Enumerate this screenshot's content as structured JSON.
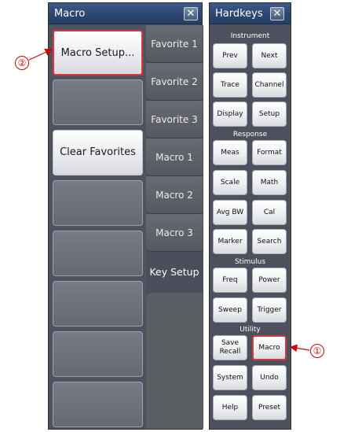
{
  "macro_panel": {
    "title": "Macro",
    "close_glyph": "✕",
    "buttons": [
      {
        "label": "Macro Setup...",
        "selected": true
      },
      {
        "label": ""
      },
      {
        "label": "Clear Favorites"
      },
      {
        "label": ""
      },
      {
        "label": ""
      },
      {
        "label": ""
      },
      {
        "label": ""
      },
      {
        "label": ""
      }
    ],
    "tabs": [
      "Favorite 1",
      "Favorite 2",
      "Favorite 3",
      "Macro 1",
      "Macro 2",
      "Macro 3",
      "Key Setup"
    ],
    "active_tab": "Key Setup"
  },
  "hardkeys_panel": {
    "title": "Hardkeys",
    "close_glyph": "✕",
    "sections": {
      "instrument": "Instrument",
      "response": "Response",
      "stimulus": "Stimulus",
      "utility": "Utility"
    },
    "keys": {
      "prev": "Prev",
      "next": "Next",
      "trace": "Trace",
      "channel": "Channel",
      "display": "Display",
      "setup": "Setup",
      "meas": "Meas",
      "format": "Format",
      "scale": "Scale",
      "math": "Math",
      "avg_bw": "Avg BW",
      "cal": "Cal",
      "marker": "Marker",
      "search": "Search",
      "freq": "Freq",
      "power": "Power",
      "sweep": "Sweep",
      "trigger": "Trigger",
      "save_recall_1": "Save",
      "save_recall_2": "Recall",
      "macro": "Macro",
      "system": "System",
      "undo": "Undo",
      "help": "Help",
      "preset": "Preset"
    }
  },
  "callouts": {
    "one": "①",
    "two": "②"
  },
  "colors": {
    "highlight": "#d9393b",
    "callout": "#d00000",
    "titlebar": "#2c4670"
  }
}
